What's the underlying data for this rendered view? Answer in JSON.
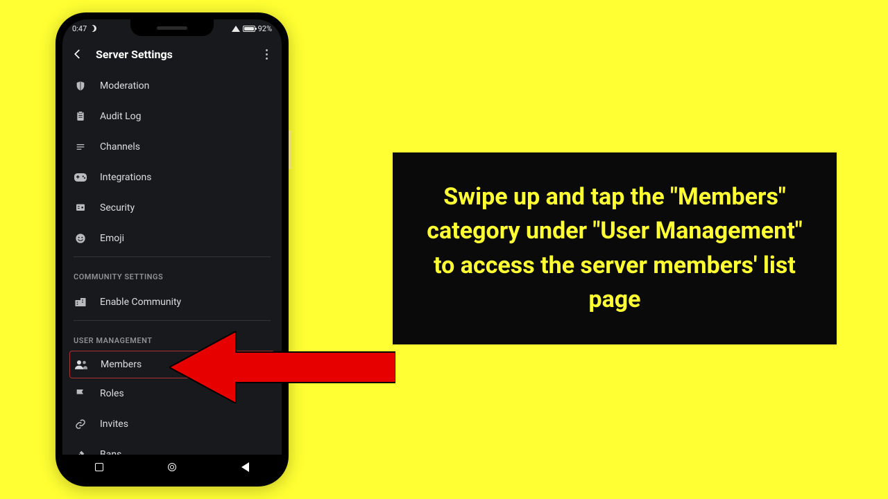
{
  "statusbar": {
    "time": "0:47",
    "battery": "92%"
  },
  "header": {
    "title": "Server Settings"
  },
  "items": {
    "moderation": "Moderation",
    "audit": "Audit Log",
    "channels": "Channels",
    "integrations": "Integrations",
    "security": "Security",
    "emoji": "Emoji",
    "enable_community": "Enable Community",
    "members": "Members",
    "roles": "Roles",
    "invites": "Invites",
    "bans": "Bans"
  },
  "sections": {
    "community": "COMMUNITY SETTINGS",
    "user_mgmt": "USER MANAGEMENT"
  },
  "instruction": "Swipe up and tap the \"Members\" category under \"User Management\" to access the server members' list page"
}
